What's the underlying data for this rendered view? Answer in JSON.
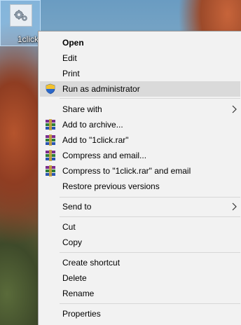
{
  "desktop": {
    "icon_label": "1click",
    "icon_name": "settings-file-icon"
  },
  "menu": {
    "items": [
      {
        "label": "Open",
        "icon": "",
        "bold": true
      },
      {
        "label": "Edit",
        "icon": ""
      },
      {
        "label": "Print",
        "icon": ""
      },
      {
        "label": "Run as administrator",
        "icon": "uac-shield-icon",
        "highlighted": true
      },
      {
        "label": "Share with",
        "icon": "",
        "submenu": true
      },
      {
        "label": "Add to archive...",
        "icon": "winrar-icon"
      },
      {
        "label": "Add to \"1click.rar\"",
        "icon": "winrar-icon"
      },
      {
        "label": "Compress and email...",
        "icon": "winrar-icon"
      },
      {
        "label": "Compress to \"1click.rar\" and email",
        "icon": "winrar-icon"
      },
      {
        "label": "Restore previous versions",
        "icon": ""
      },
      {
        "label": "Send to",
        "icon": "",
        "submenu": true
      },
      {
        "label": "Cut",
        "icon": ""
      },
      {
        "label": "Copy",
        "icon": ""
      },
      {
        "label": "Create shortcut",
        "icon": ""
      },
      {
        "label": "Delete",
        "icon": ""
      },
      {
        "label": "Rename",
        "icon": ""
      },
      {
        "label": "Properties",
        "icon": ""
      }
    ]
  },
  "colors": {
    "menu_background": "#f2f2f2",
    "menu_highlight": "#dadada",
    "menu_border": "#a0a0a0",
    "selection_blue": "#99c9ef"
  }
}
